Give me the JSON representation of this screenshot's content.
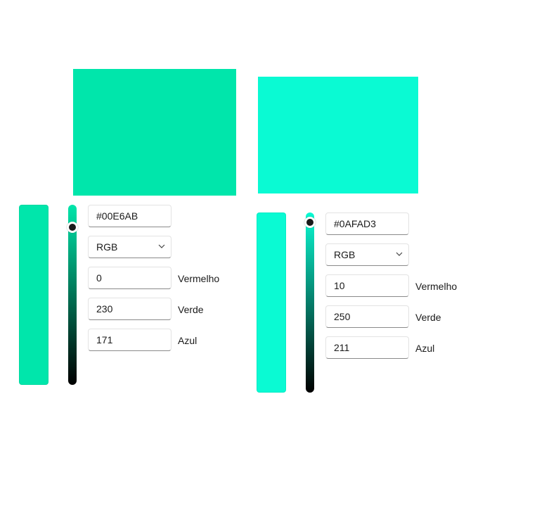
{
  "pickers": [
    {
      "color": "#00E6AB",
      "hex_value": "#00E6AB",
      "color_model": "RGB",
      "red_value": "0",
      "green_value": "230",
      "blue_value": "171",
      "red_label": "Vermelho",
      "green_label": "Verde",
      "blue_label": "Azul",
      "value_level": 0.88
    },
    {
      "color": "#0AFAD3",
      "hex_value": "#0AFAD3",
      "color_model": "RGB",
      "red_value": "10",
      "green_value": "250",
      "blue_value": "211",
      "red_label": "Vermelho",
      "green_label": "Verde",
      "blue_label": "Azul",
      "value_level": 0.95
    }
  ],
  "icons": {
    "dropdown": "chevron-down-icon"
  }
}
